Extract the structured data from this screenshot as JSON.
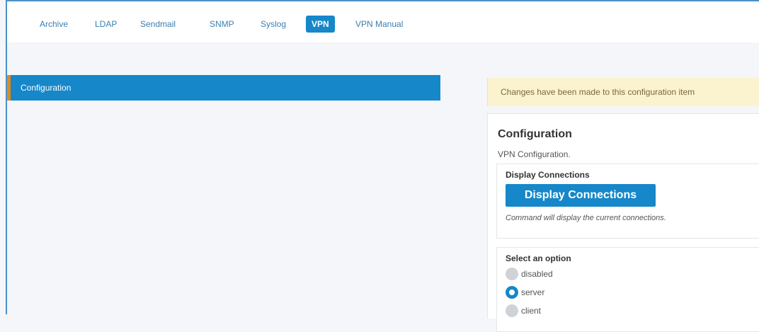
{
  "tabs": [
    {
      "label": "Archive",
      "active": false
    },
    {
      "label": "LDAP",
      "active": false
    },
    {
      "label": "Sendmail",
      "active": false
    },
    {
      "label": "SNMP",
      "active": false
    },
    {
      "label": "Syslog",
      "active": false
    },
    {
      "label": "VPN",
      "active": true
    },
    {
      "label": "VPN Manual",
      "active": false
    }
  ],
  "left_panel": {
    "title": "Configuration"
  },
  "notice": "Changes have been made to this configuration item",
  "config": {
    "title": "Configuration",
    "description": "VPN Configuration.",
    "display_section_label": "Display Connections",
    "display_button_label": "Display Connections",
    "display_hint": "Command will display the current connections.",
    "option_label": "Select an option",
    "options": [
      {
        "label": "disabled",
        "selected": false
      },
      {
        "label": "server",
        "selected": true
      },
      {
        "label": "client",
        "selected": false
      }
    ]
  },
  "colors": {
    "accent": "#1687c9",
    "left_marker": "#e08a1e",
    "notice_bg": "#fbf2cf"
  }
}
